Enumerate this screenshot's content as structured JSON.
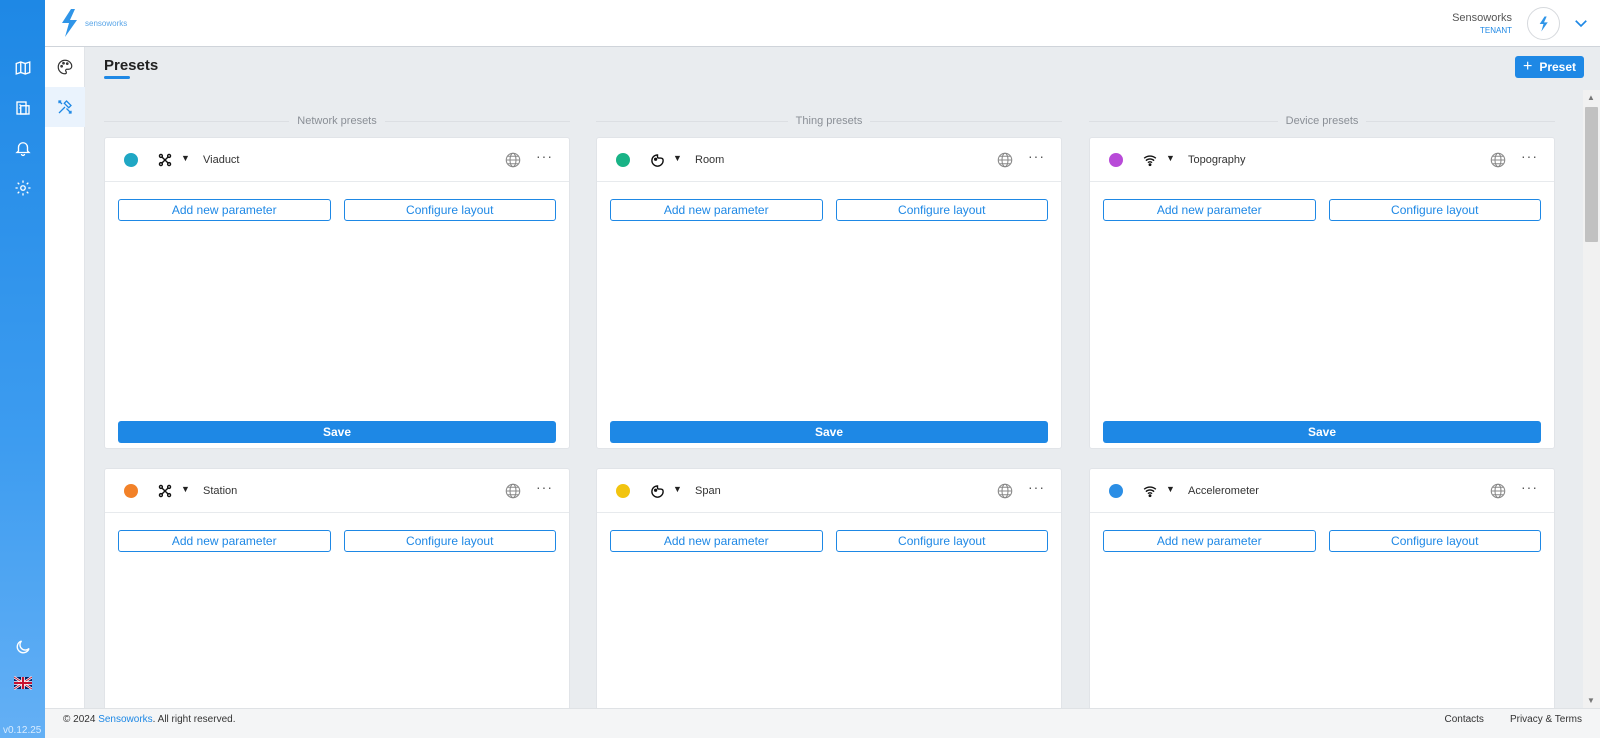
{
  "app": {
    "logo_text": "sensoworks",
    "version": "v0.12.25"
  },
  "header": {
    "user_name": "Sensoworks",
    "user_role": "TENANT"
  },
  "page": {
    "title": "Presets",
    "add_button_label": "Preset"
  },
  "columns": [
    {
      "title": "Network presets"
    },
    {
      "title": "Thing presets"
    },
    {
      "title": "Device presets"
    }
  ],
  "cards": [
    {
      "name": "Viaduct",
      "color": "#1fa7c4",
      "type_icon": "network-icon"
    },
    {
      "name": "Room",
      "color": "#19b386",
      "type_icon": "thing-icon"
    },
    {
      "name": "Topography",
      "color": "#b84ad8",
      "type_icon": "wifi-icon"
    },
    {
      "name": "Station",
      "color": "#f28128",
      "type_icon": "network-icon"
    },
    {
      "name": "Span",
      "color": "#f2c40f",
      "type_icon": "thing-icon"
    },
    {
      "name": "Accelerometer",
      "color": "#2b8ee5",
      "type_icon": "wifi-icon"
    }
  ],
  "card_labels": {
    "add_parameter": "Add new parameter",
    "configure_layout": "Configure layout",
    "save": "Save"
  },
  "footer": {
    "copyright_prefix": "© 2024",
    "brand_link": "Sensoworks",
    "copyright_suffix": ". All right reserved.",
    "contacts": "Contacts",
    "privacy": "Privacy & Terms"
  },
  "colors": {
    "accent": "#1e88e5",
    "rail": "#1e88e5"
  }
}
